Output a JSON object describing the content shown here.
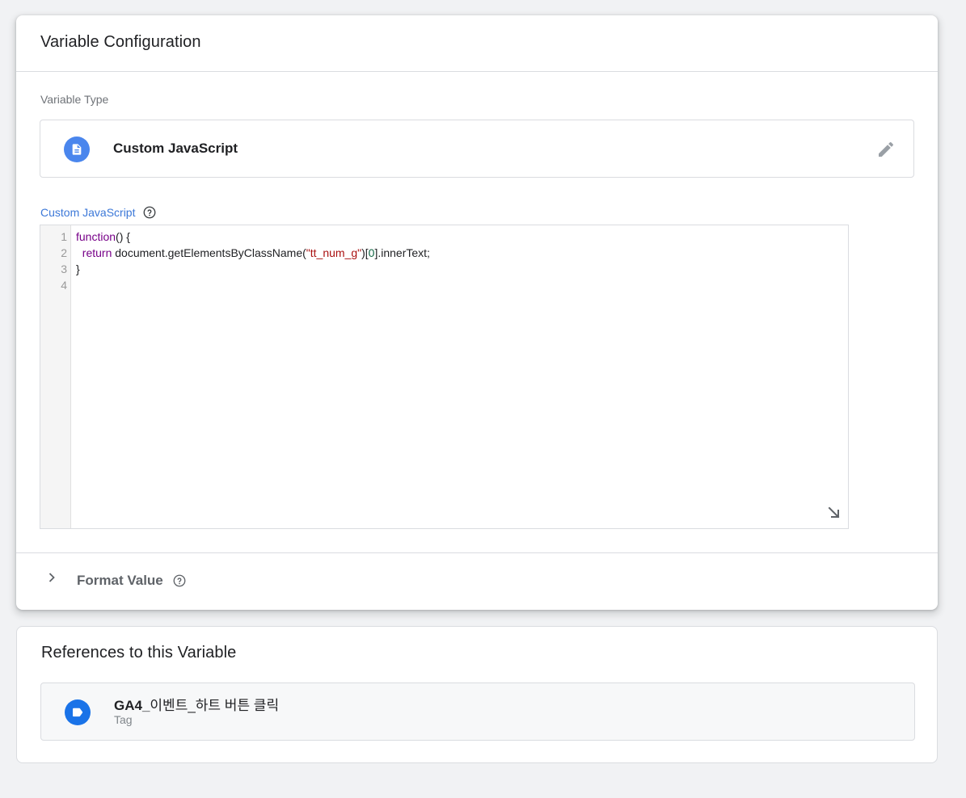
{
  "config": {
    "title": "Variable Configuration",
    "type_label": "Variable Type",
    "type_name": "Custom JavaScript",
    "type_icon": "document-icon",
    "edit_icon": "pencil-icon",
    "js_label": "Custom JavaScript",
    "line_numbers": [
      "1",
      "2",
      "3",
      "4"
    ],
    "code": {
      "line1_kw": "function",
      "line1_rest": "() {",
      "line2_indent": "  ",
      "line2_kw": "return",
      "line2_a": " document.getElementsByClassName(",
      "line2_str": "\"tt_num_g\"",
      "line2_b": ")[",
      "line2_num": "0",
      "line2_c": "].innerText;",
      "line3": "}",
      "line4": ""
    },
    "format_label": "Format Value"
  },
  "references": {
    "title": "References to this Variable",
    "items": [
      {
        "name_prefix": "GA4_",
        "name_rest": "이벤트_하트 버튼 클릭",
        "kind": "Tag",
        "icon": "tag-icon"
      }
    ]
  },
  "colors": {
    "accent": "#3c78d8",
    "type_icon_bg": "#4a86ed",
    "tag_icon_bg": "#1a73e8",
    "page_bg": "#f1f2f4"
  }
}
